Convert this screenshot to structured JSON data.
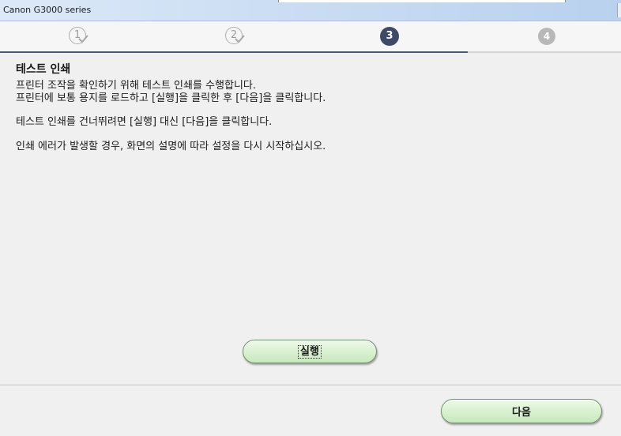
{
  "window": {
    "title": "Canon G3000 series"
  },
  "steps": [
    {
      "label": "1",
      "state": "done",
      "icon": "check-icon"
    },
    {
      "label": "2",
      "state": "done",
      "icon": "check-icon"
    },
    {
      "label": "3",
      "state": "current"
    },
    {
      "label": "4",
      "state": "upcoming"
    }
  ],
  "colors": {
    "accent": "#3d4b68",
    "button_green": "#d8f0cf",
    "titlebar": "#c9dcf3"
  },
  "content": {
    "heading": "테스트 인쇄",
    "line1": "프린터 조작을 확인하기 위해 테스트 인쇄를 수행합니다.",
    "line2": "프린터에 보통 용지를 로드하고 [실행]을 클릭한 후 [다음]을 클릭합니다.",
    "line3": "테스트 인쇄를 건너뛰려면 [실행] 대신 [다음]을 클릭합니다.",
    "line4": "인쇄 에러가 발생할 경우, 화면의 설명에 따라 설정을 다시 시작하십시오."
  },
  "buttons": {
    "run_label": "실행",
    "next_label": "다음"
  }
}
